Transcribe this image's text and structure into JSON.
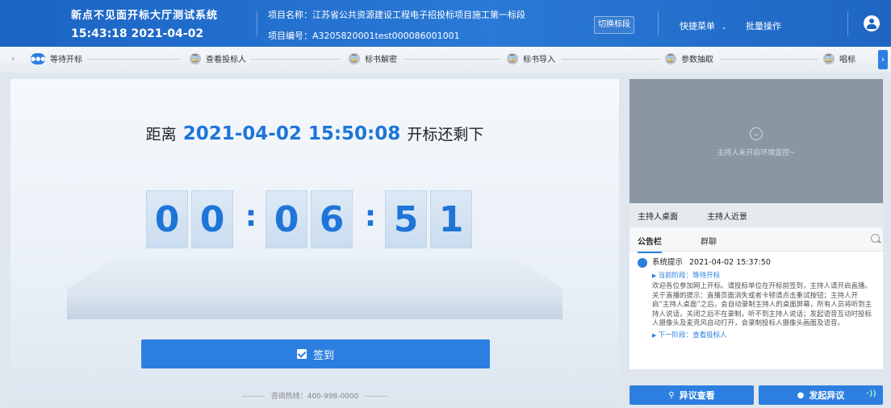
{
  "header": {
    "system_title": "新点不见面开标大厅测试系统",
    "clock": "15:43:18 2021-04-02",
    "project_name": "项目名称：江苏省公共资源建设工程电子招投标项目施工第一标段",
    "project_no": "项目编号：A3205820001test000086001001",
    "switch_label": "切换标段",
    "quick_menu": "快捷菜单",
    "batch_ops": "批量操作"
  },
  "stages": [
    {
      "label": "等待开标",
      "active": true
    },
    {
      "label": "查看投标人",
      "active": false
    },
    {
      "label": "标书解密",
      "active": false
    },
    {
      "label": "标书导入",
      "active": false
    },
    {
      "label": "参数抽取",
      "active": false
    },
    {
      "label": "唱标",
      "active": false
    }
  ],
  "countdown": {
    "prefix": "距离",
    "target": "2021-04-02 15:50:08",
    "suffix": "开标还剩下",
    "digits": [
      "0",
      "0",
      "0",
      "6",
      "5",
      "1"
    ]
  },
  "sign_button": "签到",
  "hotline": "咨询热线：400-998-0000",
  "video": {
    "message": "主持人未开启环境监控~"
  },
  "host_tabs": [
    "主持人桌面",
    "主持人近景"
  ],
  "notice": {
    "tabs": [
      "公告栏",
      "群聊"
    ],
    "sender": "系统提示",
    "time": "2021-04-02 15:37:50",
    "current_stage": "当前阶段：等待开标",
    "content": "欢迎各位参加网上开标。请投标单位在开标前签到，主持人请开启直播。关于直播的提示：直播页面消失或者卡顿请点击重试按钮；主持人开启“主持人桌面”之后，会自动录制主持人的桌面屏幕，所有人员将听到主持人说话，关闭之后不在录制，听不到主持人说话；发起语音互动时投标人摄像头及麦克风自动打开，会录制投标人摄像头画面及语音。",
    "next_stage": "下一阶段：查看投标人"
  },
  "buttons": {
    "view_objection": "异议查看",
    "raise_objection": "发起异议"
  },
  "colors": {
    "primary": "#2c7fe0",
    "header": "#1b64c4"
  }
}
